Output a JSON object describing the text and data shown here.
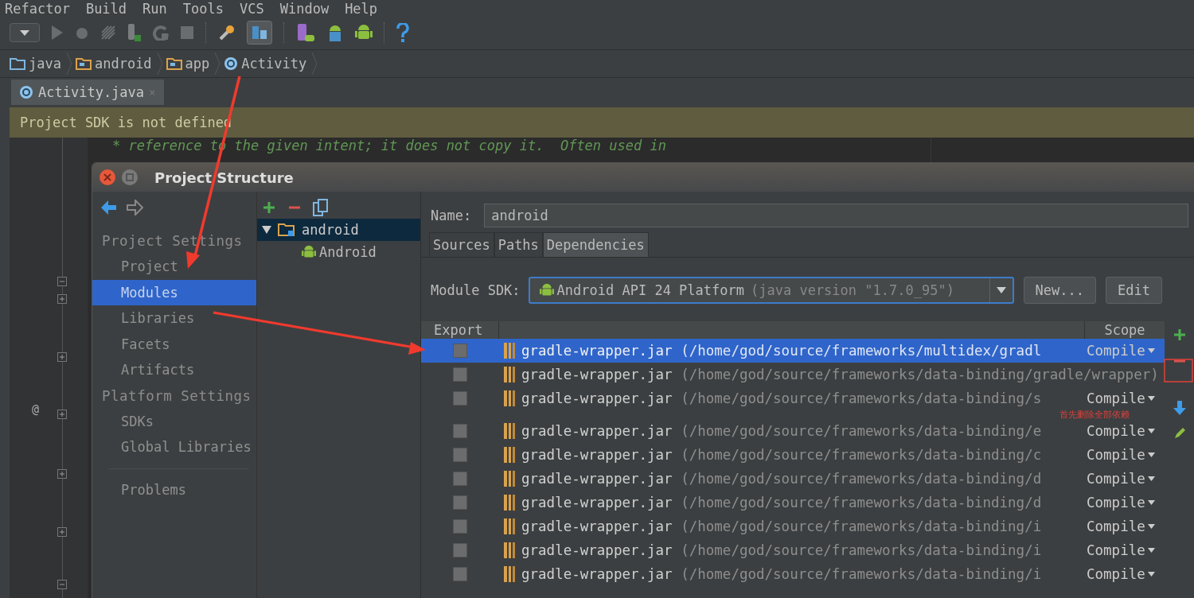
{
  "menu": [
    "Refactor",
    "Build",
    "Run",
    "Tools",
    "VCS",
    "Window",
    "Help"
  ],
  "breadcrumbs": [
    {
      "label": "java",
      "kind": "folder"
    },
    {
      "label": "android",
      "kind": "package"
    },
    {
      "label": "app",
      "kind": "package"
    },
    {
      "label": "Activity",
      "kind": "class"
    }
  ],
  "editor_tab": {
    "label": "Activity.java",
    "close": "×",
    "selected": true
  },
  "banner": "Project SDK is not defined",
  "code_lines": [
    "* reference to the given intent; it does not copy it.  Often used in"
  ],
  "gutter_mark": "@",
  "dialog": {
    "title": "Project Structure",
    "sections": [
      {
        "heading": "Project Settings",
        "items": [
          {
            "label": "Project",
            "selected": false
          },
          {
            "label": "Modules",
            "selected": true
          },
          {
            "label": "Libraries",
            "selected": false
          },
          {
            "label": "Facets",
            "selected": false
          },
          {
            "label": "Artifacts",
            "selected": false
          }
        ]
      },
      {
        "heading": "Platform Settings",
        "items": [
          {
            "label": "SDKs",
            "selected": false
          },
          {
            "label": "Global Libraries",
            "selected": false
          }
        ]
      }
    ],
    "problems": "Problems",
    "module_tree": [
      {
        "label": "android",
        "expanded": true,
        "selected": true,
        "children": [
          {
            "label": "Android",
            "selected": false
          }
        ]
      }
    ],
    "name_field": {
      "label": "Name:",
      "value": "android"
    },
    "tabs": [
      {
        "label": "Sources",
        "selected": false
      },
      {
        "label": "Paths",
        "selected": false
      },
      {
        "label": "Dependencies",
        "selected": true
      }
    ],
    "module_sdk": {
      "label": "Module SDK:",
      "value": "Android API 24 Platform",
      "detail": "(java version \"1.7.0_95\")",
      "buttons": [
        "New...",
        "Edit"
      ]
    },
    "dependencies": {
      "columns": [
        "Export",
        "Scope"
      ],
      "rows": [
        {
          "name": "gradle-wrapper.jar",
          "path": "(/home/god/source/frameworks/multidex/gradl",
          "scope": "Compile",
          "export": false,
          "selected": true
        },
        {
          "name": "gradle-wrapper.jar",
          "path": "(/home/god/source/frameworks/data-binding/gradle/wrapper)",
          "export": false,
          "selected": false
        },
        {
          "name": "gradle-wrapper.jar",
          "path": "(/home/god/source/frameworks/data-binding/s",
          "scope": "Compile",
          "export": false,
          "selected": false
        },
        {
          "name": "gradle-wrapper.jar",
          "path": "(/home/god/source/frameworks/data-binding/e",
          "scope": "Compile",
          "export": false,
          "selected": false
        },
        {
          "name": "gradle-wrapper.jar",
          "path": "(/home/god/source/frameworks/data-binding/c",
          "scope": "Compile",
          "export": false,
          "selected": false
        },
        {
          "name": "gradle-wrapper.jar",
          "path": "(/home/god/source/frameworks/data-binding/d",
          "scope": "Compile",
          "export": false,
          "selected": false
        },
        {
          "name": "gradle-wrapper.jar",
          "path": "(/home/god/source/frameworks/data-binding/d",
          "scope": "Compile",
          "export": false,
          "selected": false
        },
        {
          "name": "gradle-wrapper.jar",
          "path": "(/home/god/source/frameworks/data-binding/i",
          "scope": "Compile",
          "export": false,
          "selected": false
        },
        {
          "name": "gradle-wrapper.jar",
          "path": "(/home/god/source/frameworks/data-binding/i",
          "scope": "Compile",
          "export": false,
          "selected": false
        },
        {
          "name": "gradle-wrapper.jar",
          "path": "(/home/god/source/frameworks/data-binding/i",
          "scope": "Compile",
          "export": false,
          "selected": false
        }
      ]
    }
  },
  "annotation": {
    "text": "首先删除全部依赖"
  }
}
